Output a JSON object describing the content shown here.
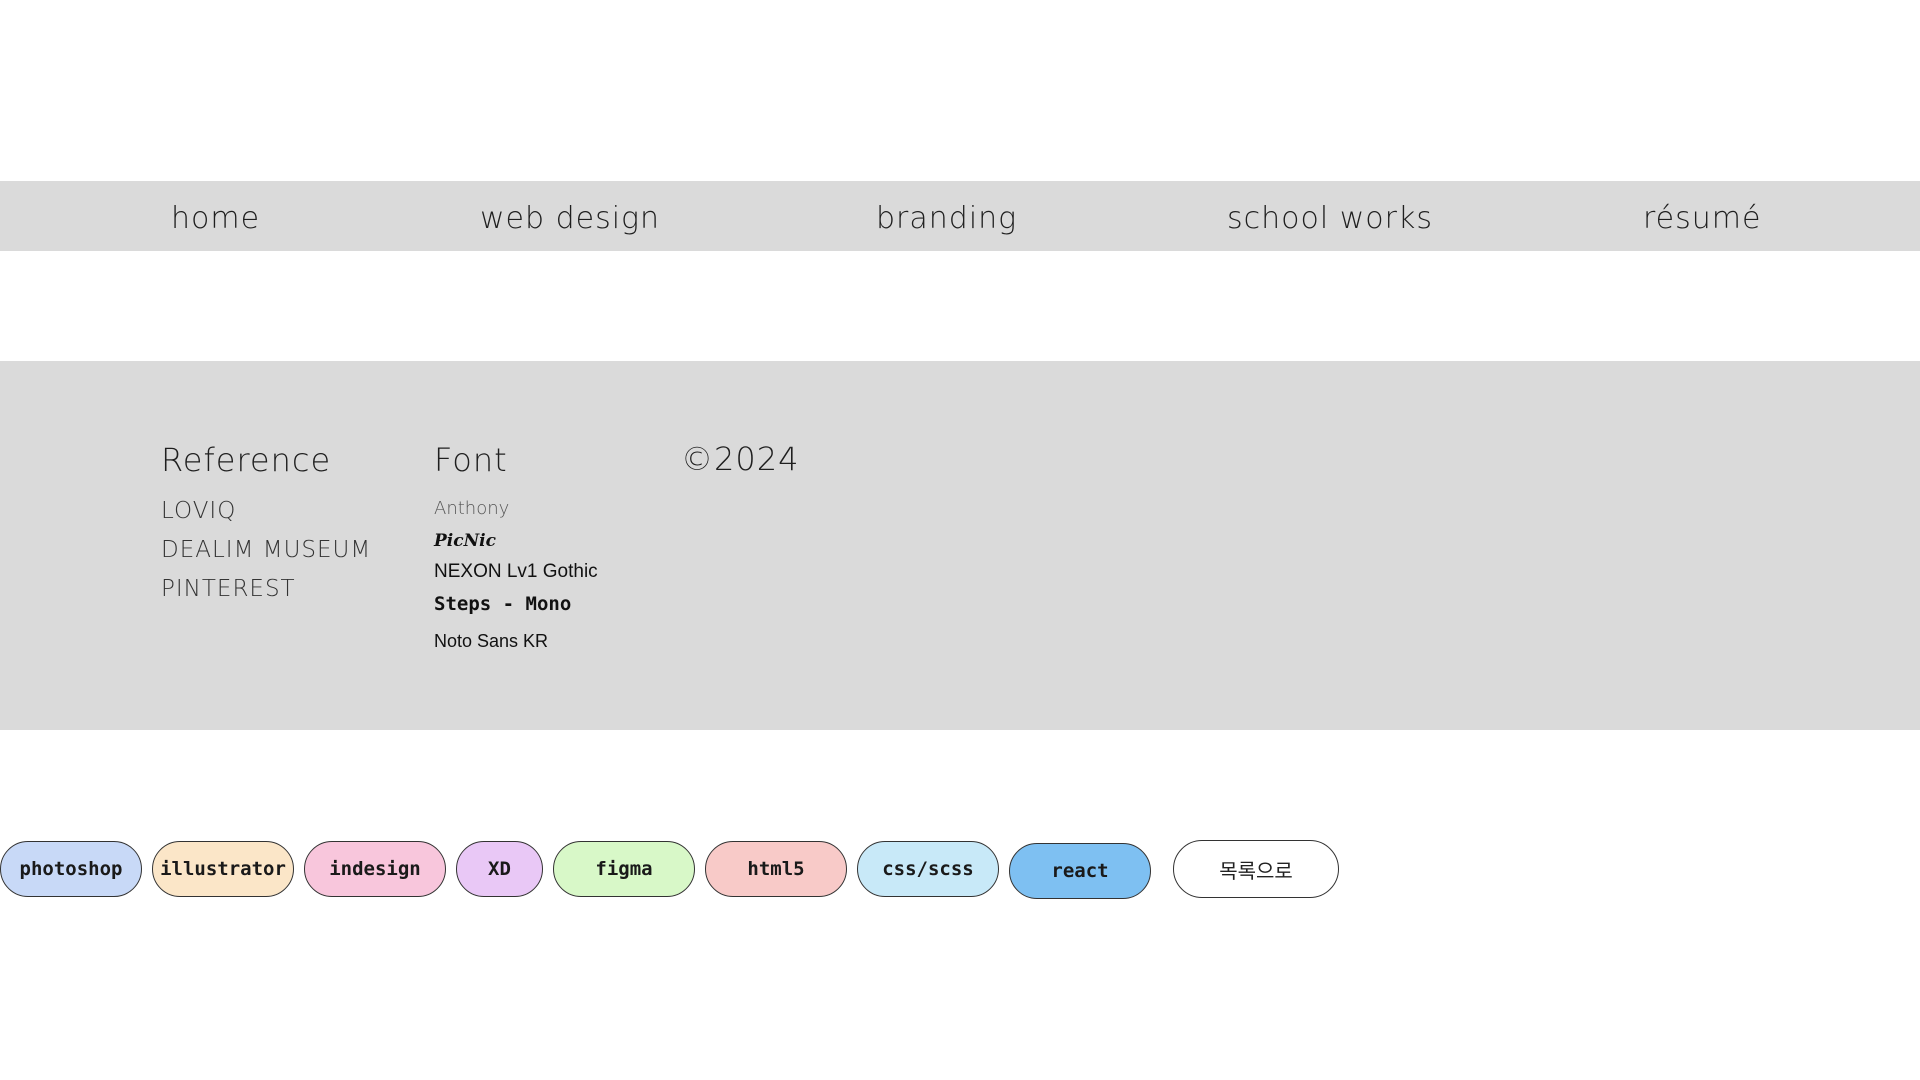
{
  "nav": {
    "items": [
      {
        "label": "home"
      },
      {
        "label": "web design"
      },
      {
        "label": "branding"
      },
      {
        "label": "school works"
      },
      {
        "label": "résumé"
      }
    ]
  },
  "footer": {
    "reference": {
      "title": "Reference",
      "links": [
        {
          "label": "LOVIQ"
        },
        {
          "label": "DEALIM MUSEUM"
        },
        {
          "label": "PINTEREST"
        }
      ]
    },
    "font": {
      "title": "Font",
      "items": [
        {
          "label": "Anthony"
        },
        {
          "label": "PicNic"
        },
        {
          "label": "NEXON Lv1 Gothic"
        },
        {
          "label": "Steps - Mono"
        },
        {
          "label": "Noto Sans KR"
        }
      ]
    },
    "copyright": "©2024"
  },
  "tools": {
    "tags": [
      {
        "label": "photoshop",
        "color": "#c8d9f7"
      },
      {
        "label": "illustrator",
        "color": "#fbe6c8"
      },
      {
        "label": "indesign",
        "color": "#f8c6dc"
      },
      {
        "label": "XD",
        "color": "#e9c8f6"
      },
      {
        "label": "figma",
        "color": "#d8f8c8"
      },
      {
        "label": "html5",
        "color": "#f8cac8"
      },
      {
        "label": "css/scss",
        "color": "#c8e9f8"
      },
      {
        "label": "react",
        "color": "#7ec0f2"
      }
    ],
    "back_label": "목록으로"
  }
}
